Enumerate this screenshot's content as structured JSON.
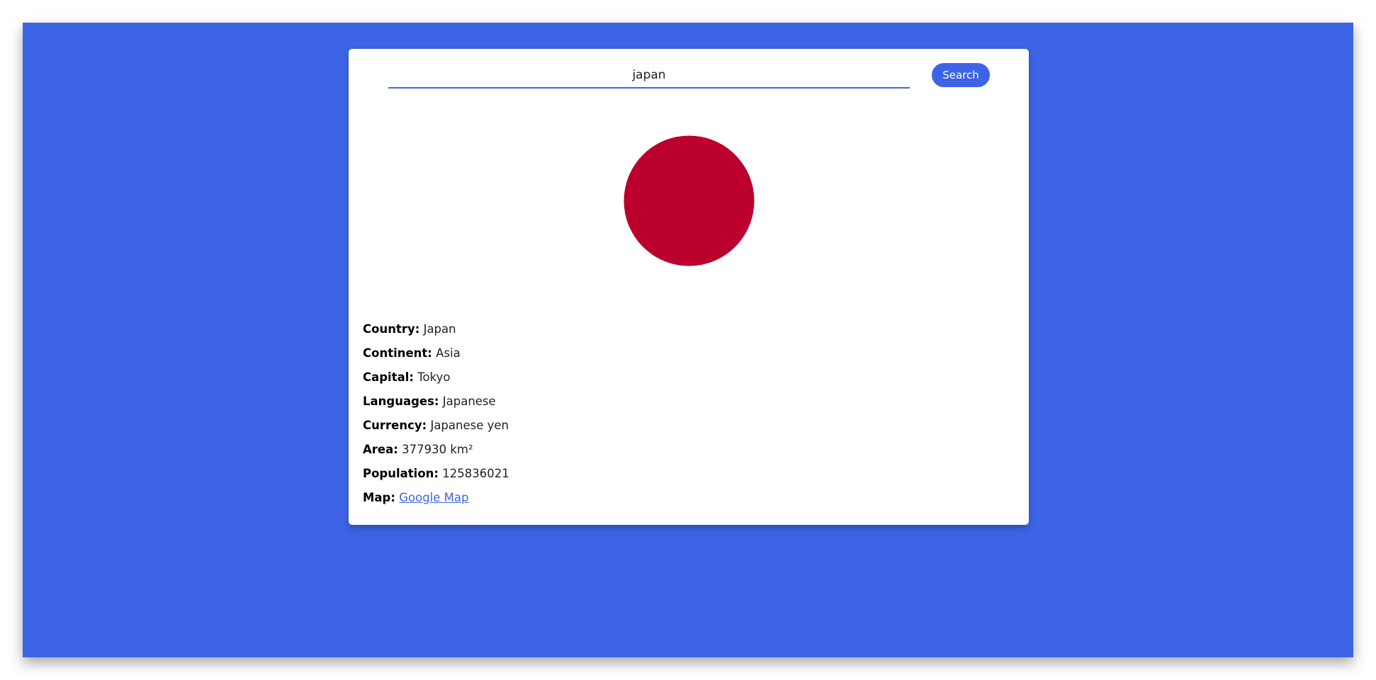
{
  "search": {
    "value": "japan",
    "button_label": "Search"
  },
  "flag": {
    "icon": "japan-flag-red-disc",
    "disc_color": "#bc002d"
  },
  "colors": {
    "accent": "#3d64e6",
    "card": "#ffffff"
  },
  "info": {
    "country_label": "Country:",
    "country_value": "Japan",
    "continent_label": "Continent:",
    "continent_value": "Asia",
    "capital_label": "Capital:",
    "capital_value": "Tokyo",
    "languages_label": "Languages:",
    "languages_value": "Japanese",
    "currency_label": "Currency:",
    "currency_value": "Japanese yen",
    "area_label": "Area:",
    "area_value": "377930 km²",
    "population_label": "Population:",
    "population_value": "125836021",
    "map_label": "Map:",
    "map_link_text": "Google Map"
  }
}
